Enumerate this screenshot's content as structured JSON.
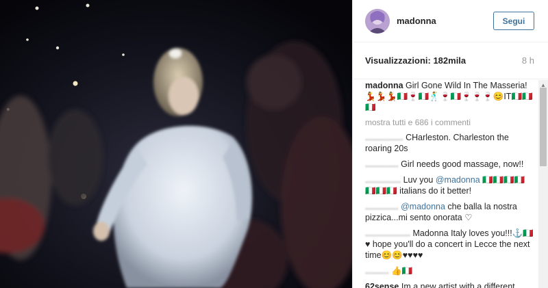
{
  "post": {
    "username": "madonna",
    "follow_label": "Segui",
    "views_label": "Visualizzazioni: 182mila",
    "time_ago": "8 h"
  },
  "caption": {
    "username": "madonna",
    "text": "Girl Gone Wild In The Masseria!",
    "emoji": "💃💃💃🇮🇹🍷🇮🇹🕺🍷🇮🇹🍷🍷🍷😊IT🇮🇹🇮🇹🇮🇹"
  },
  "show_more": "mostra tutti e 686 i commenti",
  "comments": [
    {
      "user": "................",
      "parts": [
        {
          "t": "text",
          "v": "CHarleston. Charleston the roaring 20s"
        }
      ]
    },
    {
      "user": "..............",
      "parts": [
        {
          "t": "text",
          "v": "Girl needs good massage, now!!"
        }
      ]
    },
    {
      "user": "...............",
      "parts": [
        {
          "t": "text",
          "v": "Luv you "
        },
        {
          "t": "mention",
          "v": "@madonna"
        },
        {
          "t": "text",
          "v": " 🇮🇹🇮🇹🇮🇹🇮🇹🇮🇹🇮🇹🇮🇹 italians do it better!"
        }
      ]
    },
    {
      "user": "..............",
      "parts": [
        {
          "t": "mention",
          "v": "@madonna"
        },
        {
          "t": "text",
          "v": " che balla la nostra pizzica...mi sento onorata ♡"
        }
      ]
    },
    {
      "user": "...................",
      "parts": [
        {
          "t": "text",
          "v": "Madonna Italy loves you!!!⚓🇮🇹♥ hope you'll do a concert in Lecce the next time😊😊♥♥♥♥"
        }
      ]
    },
    {
      "user": "..........",
      "parts": [
        {
          "t": "text",
          "v": "👍🇮🇹"
        }
      ]
    },
    {
      "user": "62sense",
      "plain_user": true,
      "parts": [
        {
          "t": "text",
          "v": "Im a new artist with a different"
        }
      ]
    }
  ],
  "colors": {
    "link": "#3f729b",
    "muted": "#999999",
    "text": "#262626"
  },
  "icons": {
    "scroll_up": "triangle-up-icon"
  }
}
